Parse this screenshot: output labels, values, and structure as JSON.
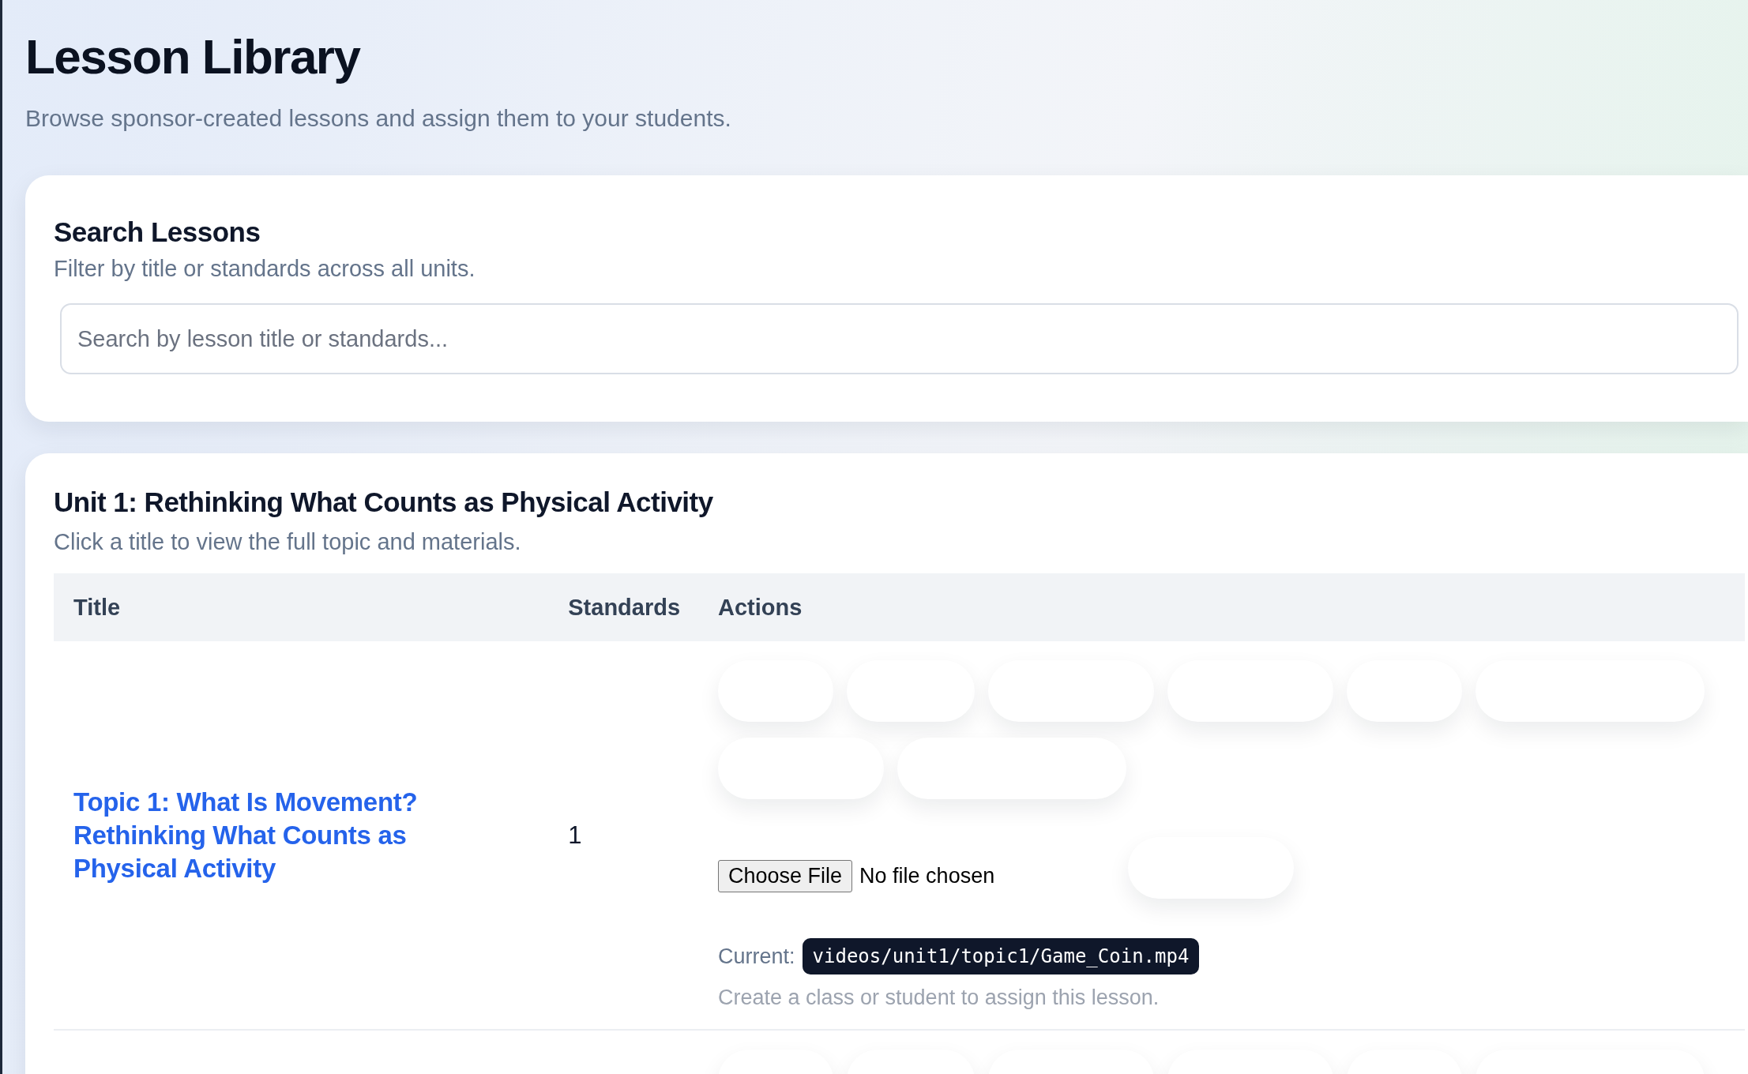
{
  "header": {
    "title": "Lesson Library",
    "subtitle": "Browse sponsor-created lessons and assign them to your students."
  },
  "search": {
    "title": "Search Lessons",
    "description": "Filter by title or standards across all units.",
    "placeholder": "Search by lesson title or standards..."
  },
  "unit": {
    "title": "Unit 1: Rethinking What Counts as Physical Activity",
    "description": "Click a title to view the full topic and materials.",
    "table": {
      "columns": [
        "Title",
        "Standards",
        "Actions"
      ],
      "rows": [
        {
          "title": "Topic 1: What Is Movement? Rethinking What Counts as Physical Activity",
          "standards": "1",
          "actions": [
            {
              "kind": "short"
            },
            {
              "kind": "mid"
            },
            {
              "kind": "long"
            },
            {
              "kind": "long"
            },
            {
              "kind": "short"
            },
            {
              "kind": "longest"
            },
            {
              "kind": "break"
            },
            {
              "kind": "long"
            },
            {
              "kind": "longest"
            }
          ],
          "upload": {
            "button": "Choose File",
            "status": "No file chosen",
            "extra": {
              "kind": "long"
            }
          },
          "current_label": "Current:",
          "current_path": "videos/unit1/topic1/Game_Coin.mp4",
          "note": "Create a class or student to assign this lesson."
        },
        {
          "actions": [
            {
              "kind": "short"
            },
            {
              "kind": "mid"
            },
            {
              "kind": "long"
            },
            {
              "kind": "long"
            },
            {
              "kind": "short"
            },
            {
              "kind": "longest"
            }
          ]
        }
      ]
    }
  }
}
